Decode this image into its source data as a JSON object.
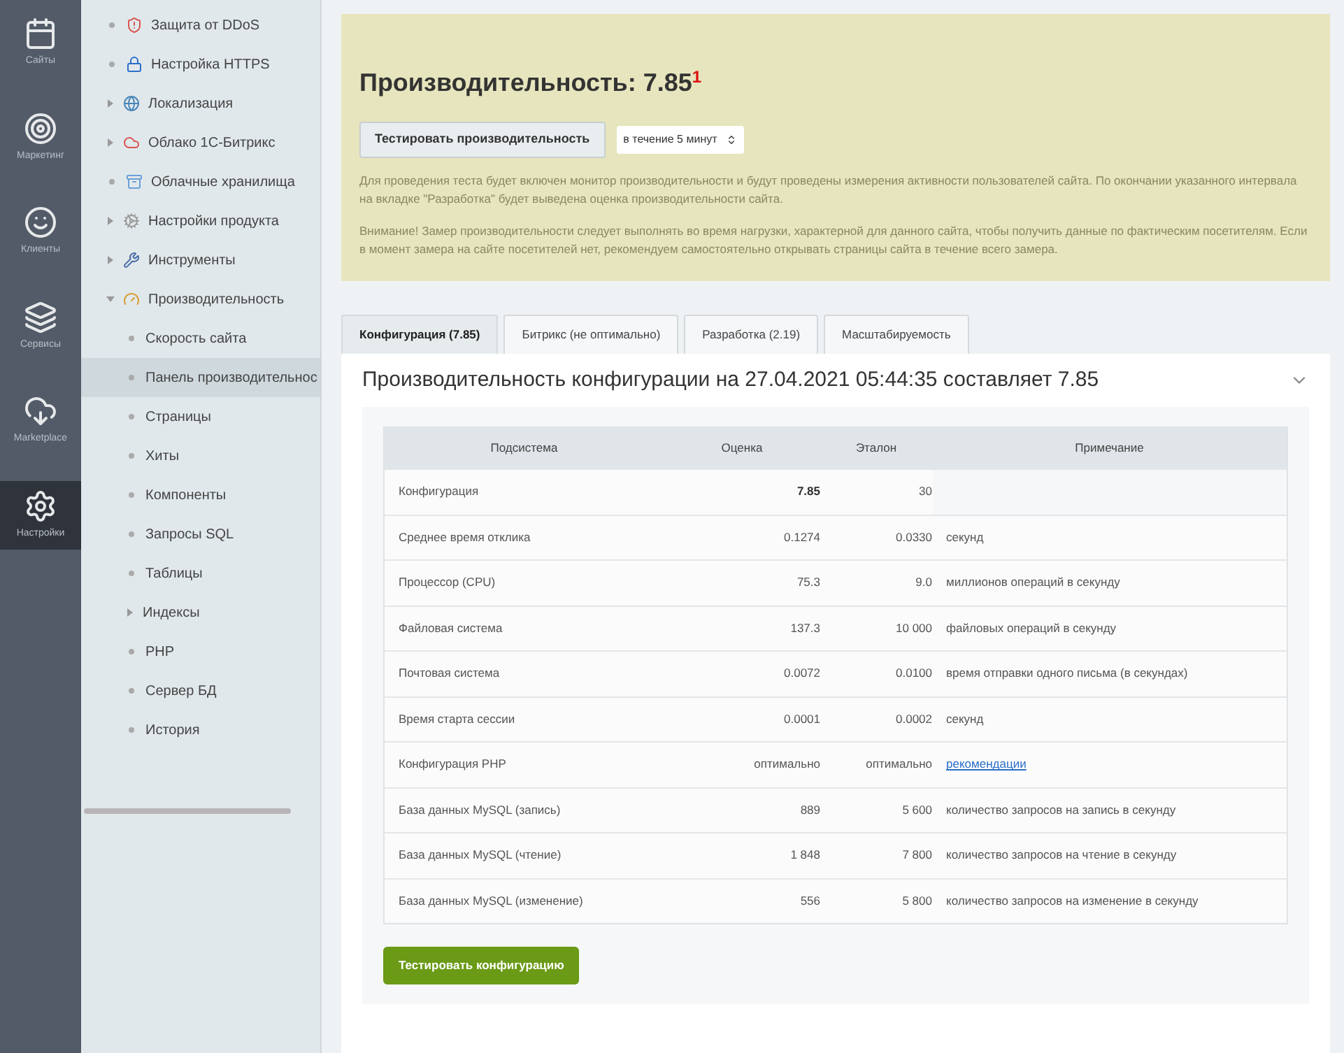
{
  "rail": [
    {
      "label": "Сайты",
      "selected": false
    },
    {
      "label": "Маркетинг",
      "selected": false
    },
    {
      "label": "Клиенты",
      "selected": false
    },
    {
      "label": "Сервисы",
      "selected": false
    },
    {
      "label": "Marketplace",
      "selected": false
    },
    {
      "label": "Настройки",
      "selected": true
    }
  ],
  "sidebar": {
    "items": [
      {
        "label": "Защита от DDoS",
        "kind": "leaf",
        "selected": false
      },
      {
        "label": "Настройка HTTPS",
        "kind": "leaf",
        "selected": false
      },
      {
        "label": "Локализация",
        "kind": "folder",
        "expanded": false,
        "selected": false
      },
      {
        "label": "Облако 1С-Битрикс",
        "kind": "folder",
        "expanded": false,
        "selected": false
      },
      {
        "label": "Облачные хранилища",
        "kind": "leaf",
        "selected": false
      },
      {
        "label": "Настройки продукта",
        "kind": "folder",
        "expanded": false,
        "selected": false
      },
      {
        "label": "Инструменты",
        "kind": "folder",
        "expanded": false,
        "selected": false
      },
      {
        "label": "Производительность",
        "kind": "folder",
        "expanded": true,
        "selected": false,
        "children": [
          {
            "label": "Скорость сайта",
            "kind": "leaf",
            "selected": false
          },
          {
            "label": "Панель производительнос",
            "kind": "leaf",
            "selected": true
          },
          {
            "label": "Страницы",
            "kind": "leaf",
            "selected": false
          },
          {
            "label": "Хиты",
            "kind": "leaf",
            "selected": false
          },
          {
            "label": "Компоненты",
            "kind": "leaf",
            "selected": false
          },
          {
            "label": "Запросы SQL",
            "kind": "leaf",
            "selected": false
          },
          {
            "label": "Таблицы",
            "kind": "leaf",
            "selected": false
          },
          {
            "label": "Индексы",
            "kind": "folder",
            "expanded": false,
            "selected": false
          },
          {
            "label": "PHP",
            "kind": "leaf",
            "selected": false
          },
          {
            "label": "Сервер БД",
            "kind": "leaf",
            "selected": false
          },
          {
            "label": "История",
            "kind": "leaf",
            "selected": false
          }
        ]
      }
    ]
  },
  "notice": {
    "title": "Производительность: 7.85",
    "footnote": "1",
    "button": "Тестировать производительность",
    "duration": "в течение 5 минут",
    "paragraphs": [
      "Для проведения теста будет включен монитор производительности и будут проведены измерения активности пользователей сайта. По окончании указанного интервала на вкладке \"Разработка\" будет выведена оценка производительности сайта.",
      "Внимание! Замер производительности следует выполнять во время нагрузки, характерной для данного сайта, чтобы получить данные по фактическим посетителям. Если в момент замера на сайте посетителей нет, рекомендуем самостоятельно открывать страницы сайта в течение всего замера."
    ]
  },
  "tabs": [
    {
      "label": "Конфигурация (7.85)",
      "selected": true
    },
    {
      "label": "Битрикс (не оптимально)",
      "selected": false
    },
    {
      "label": "Разработка (2.19)",
      "selected": false
    },
    {
      "label": "Масштабируемость",
      "selected": false
    }
  ],
  "panel": {
    "title": "Производительность конфигурации на 27.04.2021 05:44:35 составляет 7.85",
    "table": {
      "columns": [
        "Подсистема",
        "Оценка",
        "Эталон",
        "Примечание"
      ],
      "rows": [
        {
          "kind": "total",
          "cells": [
            "Конфигурация",
            "7.85",
            "30"
          ]
        },
        {
          "kind": "metric",
          "cells": [
            "Среднее время отклика",
            "0.1274",
            "0.0330",
            "секунд"
          ]
        },
        {
          "kind": "metric",
          "cells": [
            "Процессор (CPU)",
            "75.3",
            "9.0",
            "миллионов операций в секунду"
          ]
        },
        {
          "kind": "metric",
          "cells": [
            "Файловая система",
            "137.3",
            "10 000",
            "файловых операций в секунду"
          ]
        },
        {
          "kind": "metric",
          "cells": [
            "Почтовая система",
            "0.0072",
            "0.0100",
            "время отправки одного письма (в секундах)"
          ]
        },
        {
          "kind": "metric",
          "cells": [
            "Время старта сессии",
            "0.0001",
            "0.0002",
            "секунд"
          ]
        },
        {
          "kind": "link",
          "cells": [
            "Конфигурация PHP",
            "оптимально",
            "оптимально",
            "рекомендации"
          ]
        },
        {
          "kind": "metric",
          "cells": [
            "База данных MySQL (запись)",
            "889",
            "5 600",
            "количество запросов на запись в секунду"
          ]
        },
        {
          "kind": "metric",
          "cells": [
            "База данных MySQL (чтение)",
            "1 848",
            "7 800",
            "количество запросов на чтение в секунду"
          ]
        },
        {
          "kind": "metric",
          "cells": [
            "База данных MySQL (изменение)",
            "556",
            "5 800",
            "количество запросов на изменение в секунду"
          ]
        }
      ]
    },
    "button": "Тестировать конфигурацию"
  }
}
